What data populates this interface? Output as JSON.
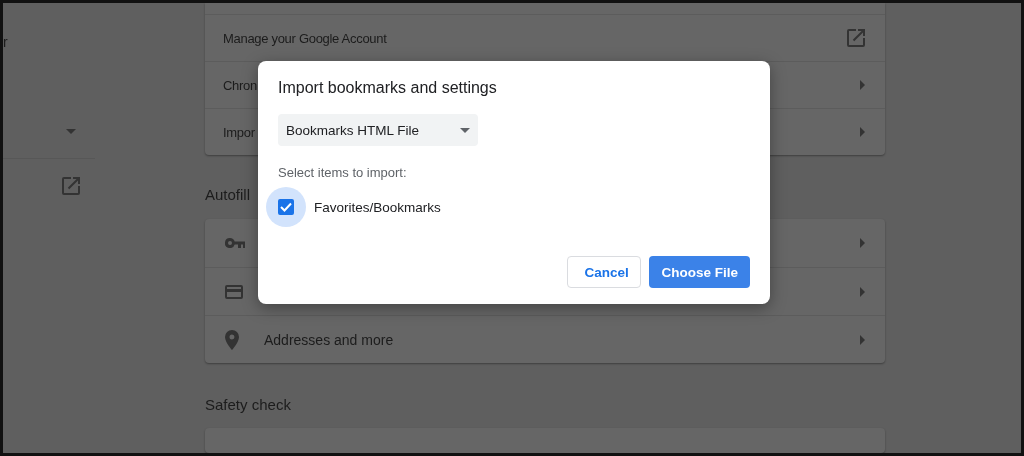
{
  "sidebar": {
    "label_fragment": "r"
  },
  "account_section": {
    "rows": [
      {
        "label": "Manage your Google Account",
        "kind": "external"
      },
      {
        "label": "Chron",
        "kind": "chevron"
      },
      {
        "label": "Impor",
        "kind": "chevron"
      }
    ]
  },
  "autofill": {
    "heading": "Autofill",
    "rows": [
      {
        "kind": "key"
      },
      {
        "kind": "card"
      },
      {
        "kind": "pin",
        "label": "Addresses and more"
      }
    ]
  },
  "safety_check": {
    "heading": "Safety check"
  },
  "dialog": {
    "title": "Import bookmarks and settings",
    "source_select": {
      "value": "Bookmarks HTML File"
    },
    "prompt": "Select items to import:",
    "options": [
      {
        "label": "Favorites/Bookmarks",
        "checked": true
      }
    ],
    "buttons": [
      {
        "label": "Cancel",
        "kind": "secondary"
      },
      {
        "label": "Choose File",
        "kind": "primary"
      }
    ]
  }
}
